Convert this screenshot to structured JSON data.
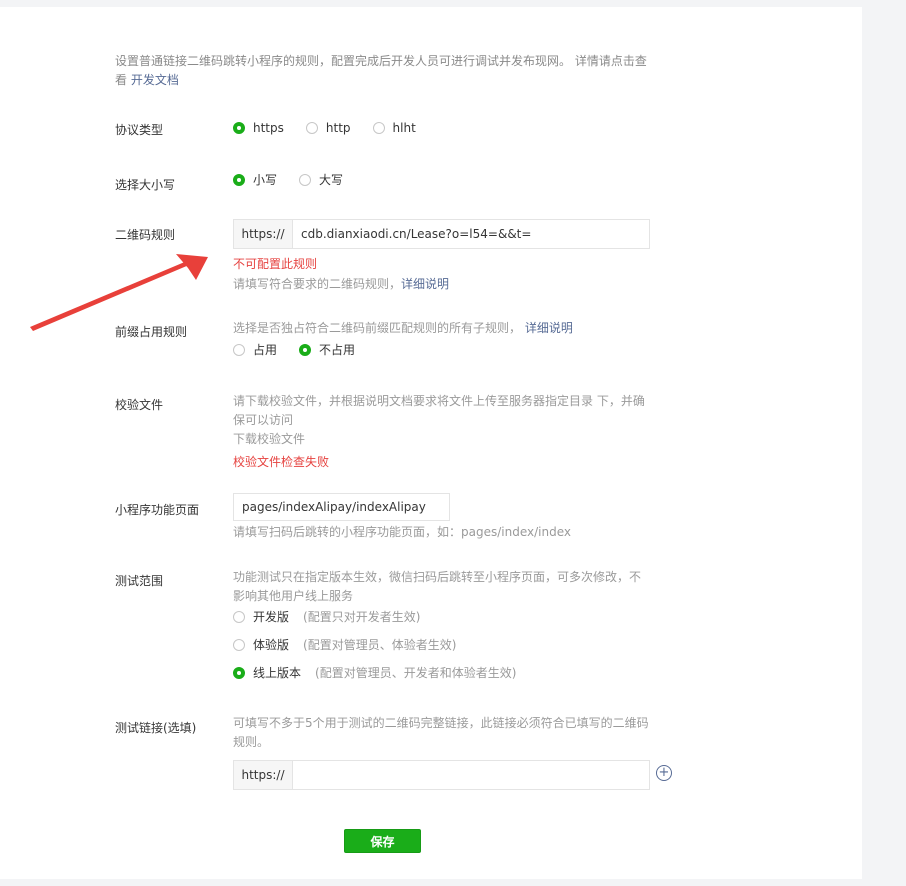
{
  "intro": {
    "text": "设置普通链接二维码跳转小程序的规则，配置完成后开发人员可进行调试并发布现网。 详情请点击查看",
    "link": "开发文档"
  },
  "protocol": {
    "label": "协议类型",
    "options": [
      "https",
      "http",
      "hlht"
    ],
    "selected": "https"
  },
  "case": {
    "label": "选择大小写",
    "options": [
      "小写",
      "大写"
    ],
    "selected": "小写"
  },
  "qr_rule": {
    "label": "二维码规则",
    "prefix": "https://",
    "value": "cdb.dianxiaodi.cn/Lease?o=l54=&&t=",
    "error": "不可配置此规则",
    "help": "请填写符合要求的二维码规则，",
    "help_link": "详细说明"
  },
  "prefix_rule": {
    "label": "前缀占用规则",
    "desc": "选择是否独占符合二维码前缀匹配规则的所有子规则，",
    "desc_link": "详细说明",
    "options": [
      "占用",
      "不占用"
    ],
    "selected": "不占用"
  },
  "verify_file": {
    "label": "校验文件",
    "desc_line1": "请下载校验文件，并根据说明文档要求将文件上传至服务器指定目录 下，并确",
    "desc_line2": "保可以访问",
    "download_link": "下载校验文件",
    "error": "校验文件检查失败"
  },
  "page": {
    "label": "小程序功能页面",
    "value": "pages/indexAlipay/indexAlipay",
    "help": "请填写扫码后跳转的小程序功能页面，如：pages/index/index"
  },
  "test_scope": {
    "label": "测试范围",
    "desc_line1": "功能测试只在指定版本生效，微信扫码后跳转至小程序页面，可多次修改，不",
    "desc_line2": "影响其他用户线上服务",
    "options": [
      {
        "name": "开发版",
        "note": "(配置只对开发者生效)"
      },
      {
        "name": "体验版",
        "note": "(配置对管理员、体验者生效)"
      },
      {
        "name": "线上版本",
        "note": "(配置对管理员、开发者和体验者生效)"
      }
    ],
    "selected": "线上版本"
  },
  "test_link": {
    "label": "测试链接(选填)",
    "desc_line1": "可填写不多于5个用于测试的二维码完整链接，此链接必须符合已填写的二维码",
    "desc_line2": "规则。",
    "prefix": "https://",
    "value": "",
    "add_icon": "plus-circle-icon"
  },
  "save_label": "保存",
  "colors": {
    "accent": "#1aad19",
    "link": "#576b95",
    "error": "#e64340",
    "arrow": "#e8403a"
  }
}
